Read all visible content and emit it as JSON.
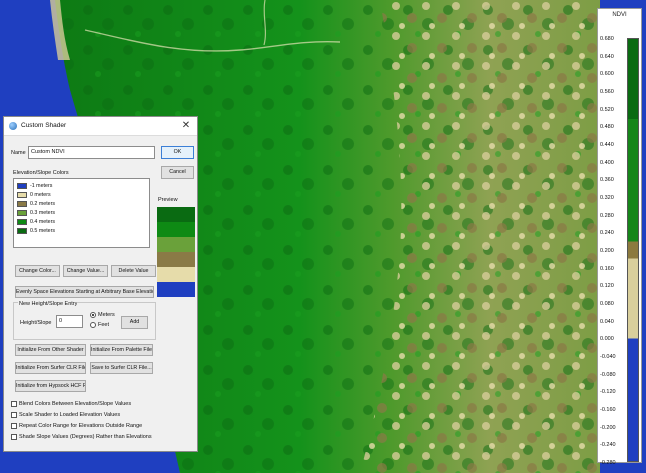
{
  "legend": {
    "title": "NDVI",
    "ticks": [
      "0.680",
      "0.640",
      "0.600",
      "0.560",
      "0.520",
      "0.480",
      "0.440",
      "0.400",
      "0.360",
      "0.320",
      "0.280",
      "0.240",
      "0.200",
      "0.160",
      "0.120",
      "0.080",
      "0.040",
      "0.000",
      "-0.040",
      "-0.080",
      "-0.120",
      "-0.160",
      "-0.200",
      "-0.240",
      "-0.280"
    ],
    "colors": [
      "#0a6b12",
      "#16861a",
      "#8c7a3e",
      "#d9cf9c",
      "#1f3fc0"
    ]
  },
  "dialog": {
    "title": "Custom Shader",
    "name_label": "Name",
    "name_value": "Custom NDVI",
    "ok": "OK",
    "cancel": "Cancel",
    "colors_label": "Elevation/Slope Colors",
    "preview_label": "Preview",
    "items": [
      {
        "label": "-1 meters",
        "color": "#1f3fc0"
      },
      {
        "label": "0 meters",
        "color": "#e6dcaa"
      },
      {
        "label": "0.2 meters",
        "color": "#8a7a46"
      },
      {
        "label": "0.3 meters",
        "color": "#6aa13a"
      },
      {
        "label": "0.4 meters",
        "color": "#0e8a14"
      },
      {
        "label": "0.5 meters",
        "color": "#0a6b12"
      }
    ],
    "change_color": "Change Color...",
    "change_value": "Change Value...",
    "delete_value": "Delete Value",
    "evenly_space": "Evenly Space Elevations Starting at Arbitrary Base Elevation...",
    "new_entry_label": "New Height/Slope Entry",
    "height_label": "Height/Slope",
    "height_value": "0",
    "meters": "Meters",
    "feet": "Feet",
    "add": "Add",
    "init_other": "Initialize From Other Shader",
    "init_palette": "Initialize From Palette File...",
    "init_surfer": "Initialize From Surfer CLR File...",
    "save_surfer": "Save to Surfer CLR File...",
    "init_hypsock": "Initialize from Hypsock HCF File...",
    "checks": [
      "Blend Colors Between Elevation/Slope Values",
      "Scale Shader to Loaded Elevation Values",
      "Repeat Color Range for Elevations Outside Range",
      "Shade Slope Values (Degrees) Rather than Elevations"
    ]
  }
}
